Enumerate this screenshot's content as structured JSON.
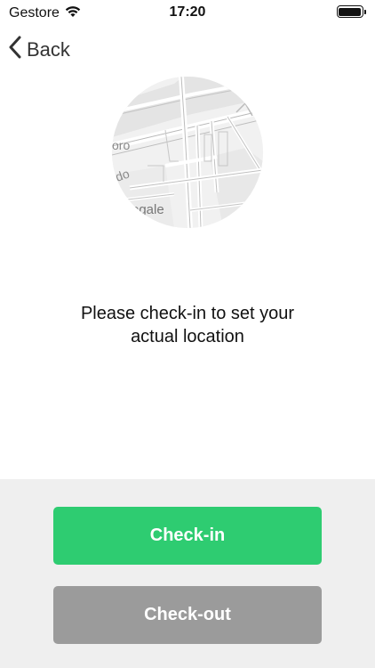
{
  "status_bar": {
    "carrier": "Gestore",
    "time": "17:20",
    "battery_level": 1.0
  },
  "nav": {
    "back_label": "Back"
  },
  "map": {
    "labels": [
      "oro",
      "do",
      "egale"
    ]
  },
  "message": {
    "line1": "Please check-in to set your",
    "line2": "actual location"
  },
  "actions": {
    "checkin_label": "Check-in",
    "checkout_label": "Check-out"
  },
  "colors": {
    "checkin": "#2ecc71",
    "checkout": "#9b9b9b",
    "panel": "#efefef"
  }
}
